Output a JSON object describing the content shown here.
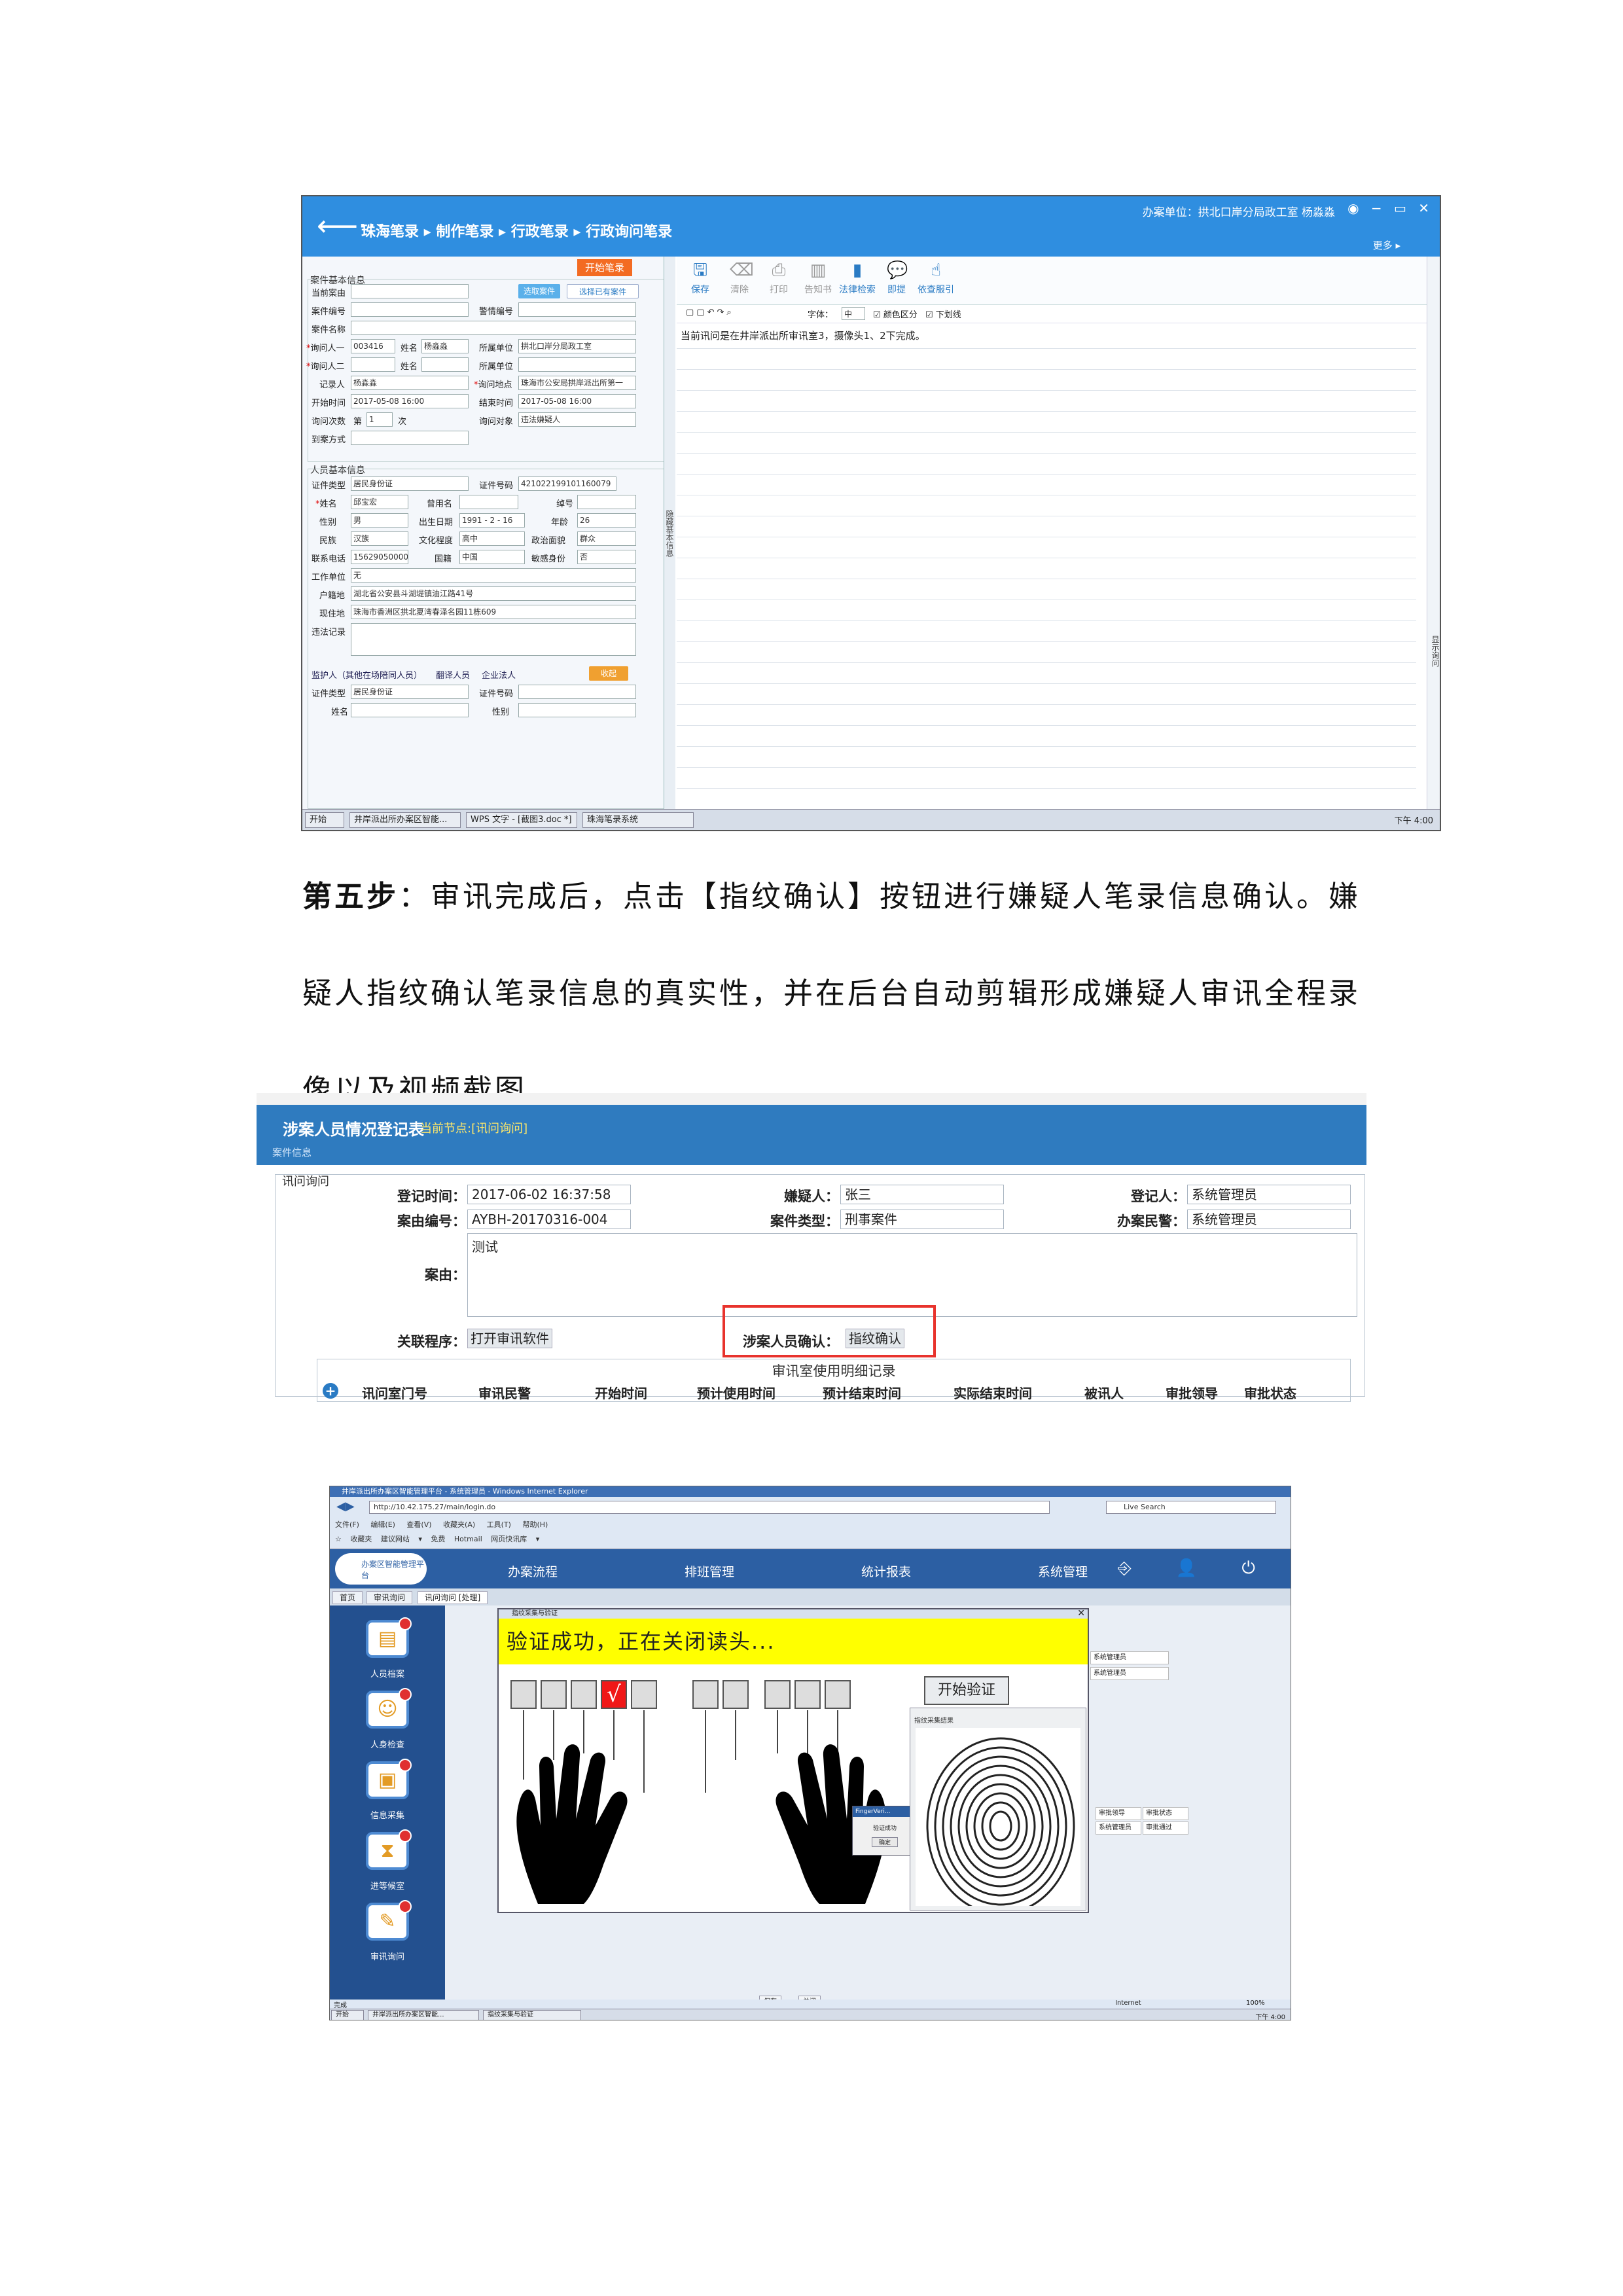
{
  "shot1": {
    "back_arrow": "⟵···",
    "breadcrumb": "珠海笔录 ▸ 制作笔录 ▸ 行政笔录 ▸ 行政询问笔录",
    "unit": "办案单位：拱北口岸分局政工室  杨淼淼",
    "win_buttons": "◉ − ▭ ✕",
    "more": "更多 ▸",
    "start_btn": "开始笔录",
    "case_section": "案件基本信息",
    "person_section": "人员基本信息",
    "fields": {
      "current_case_label": "当前案由",
      "select_case_btn": "选取案件",
      "select_existing_btn": "选择已有案件",
      "case_no_label": "案件编号",
      "alarm_no_label": "警情编号",
      "case_name_label": "案件名称",
      "asker1_label": "询问人一",
      "asker1_id": "003416",
      "name_label": "姓名",
      "asker1_name": "杨淼淼",
      "unit_label": "所属单位",
      "asker1_unit": "拱北口岸分局政工室",
      "asker2_label": "询问人二",
      "recorder_label": "记录人",
      "recorder": "杨淼淼",
      "place_label": "询问地点",
      "place": "珠海市公安局拱岸派出所第一",
      "start_label": "开始时间",
      "start_time": "2017-05-08 16:00",
      "end_label": "结束时间",
      "end_time": "2017-05-08 16:00",
      "count_label": "询问次数",
      "count_prefix": "第",
      "count_value": "1",
      "count_suffix": "次",
      "object_label": "询问对象",
      "object_value": "违法嫌疑人",
      "notify_label": "到案方式",
      "id_type_label": "证件类型",
      "id_type": "居民身份证",
      "id_no_label": "证件号码",
      "id_no": "421022199101160079",
      "pname_label": "姓名",
      "pname": "邱宝宏",
      "alias_label": "曾用名",
      "nickname_label": "绰号",
      "gender_label": "性别",
      "gender": "男",
      "birth_label": "出生日期",
      "birth": "1991 - 2 - 16",
      "age_label": "年龄",
      "age": "26",
      "nation_label": "民族",
      "nation": "汉族",
      "edu_label": "文化程度",
      "edu": "高中",
      "politics_label": "政治面貌",
      "politics": "群众",
      "phone_label": "联系电话",
      "phone": "15629050000",
      "country_label": "国籍",
      "country": "中国",
      "sensitive_label": "敏感身份",
      "sensitive": "否",
      "work_label": "工作单位",
      "work": "无",
      "household_label": "户籍地",
      "household": "湖北省公安县斗湖堤镇油江路41号",
      "current_label": "现住地",
      "current": "珠海市香洲区拱北夏湾春泽名园11栋609",
      "record_label": "违法记录",
      "guardian_tab1": "监护人（其他在场陪同人员）",
      "guardian_tab2": "翻译人员",
      "guardian_tab3": "企业法人",
      "collect_btn": "收起",
      "g_id_type_label": "证件类型",
      "g_id_type": "居民身份证",
      "g_id_no_label": "证件号码",
      "g_name_label": "姓名",
      "g_gender_label": "性别"
    },
    "divider_label": "隐藏基本信息",
    "side_label": "显示询问",
    "toolbar": [
      "保存",
      "清除",
      "打印",
      "告知书",
      "法律检索",
      "即提",
      "依查服引"
    ],
    "font_label": "字体：",
    "font_value": "中",
    "color_check": "颜色区分",
    "underline_check": "下划线",
    "body_text": "当前讯问是在井岸派出所审讯室3，摄像头1、2下完成。",
    "taskbar": [
      "开始",
      "井岸派出所办案区智能...",
      "WPS 文字 - [截图3.doc *]",
      "珠海笔录系统"
    ],
    "tray_time": "下午 4:00"
  },
  "paragraph": {
    "step_label": "第五步",
    "line1_rest": "：审讯完成后，点击【指纹确认】按钮进行嫌疑人笔录信息确认。嫌",
    "line2": "疑人指纹确认笔录信息的真实性，并在后台自动剪辑形成嫌疑人审讯全程录",
    "line3": "像以及视频截图。"
  },
  "shot2": {
    "title": "涉案人员情况登记表",
    "node": "当前节点:[讯问询问]",
    "sub": "案件信息",
    "legend": "讯问询问",
    "reg_time_label": "登记时间：",
    "reg_time": "2017-06-02 16:37:58",
    "suspect_label": "嫌疑人：",
    "suspect": "张三",
    "registrar_label": "登记人：",
    "registrar": "系统管理员",
    "case_no_label": "案由编号：",
    "case_no": "AYBH-20170316-004",
    "case_type_label": "案件类型：",
    "case_type": "刑事案件",
    "officer_label": "办案民警：",
    "officer": "系统管理员",
    "reason_label": "案由：",
    "reason": "测试",
    "program_label": "关联程序：",
    "program_btn": "打开审讯软件",
    "confirm_label": "涉案人员确认：",
    "confirm_btn": "指纹确认",
    "grid_caption": "审讯室使用明细记录",
    "grid_headers": [
      "讯问室门号",
      "审讯民警",
      "开始时间",
      "预计使用时间",
      "预计结束时间",
      "实际结束时间",
      "被讯人",
      "审批领导",
      "审批状态"
    ]
  },
  "shot3": {
    "ie_title": "井岸派出所办案区智能管理平台 - 系统管理员 - Windows Internet Explorer",
    "address": "http://10.42.175.27/main/login.do",
    "search": "Live Search",
    "menu": "文件(F) 编辑(E) 查看(V) 收藏夹(A) 工具(T) 帮助(H)",
    "favbar": "☆ 收藏夹  建议网站 ▾  免费 Hotmail  网页快讯库 ▾",
    "logo_text": "办案区智能管理平台",
    "nav": [
      "办案流程",
      "排班管理",
      "统计报表",
      "系统管理"
    ],
    "nav_icons": "⎆ 👤 ⏻",
    "tabs": [
      "首页",
      "审讯询问",
      "讯问询问 [处理]"
    ],
    "sidebar": [
      {
        "icon": "▤",
        "label": "人员档案"
      },
      {
        "icon": "☺",
        "label": "人身检查"
      },
      {
        "icon": "▣",
        "label": "信息采集"
      },
      {
        "icon": "⧗",
        "label": "进等候室"
      },
      {
        "icon": "✎",
        "label": "审讯询问"
      }
    ],
    "dialog_title": "指纹采集与验证",
    "yellow_msg": "验证成功，正在关闭读头...",
    "check_mark": "√",
    "verify_btn": "开始验证",
    "fp_label": "指纹采集结果",
    "popup_title": "FingerVeri...",
    "popup_msg": "验证成功",
    "popup_ok": "确定",
    "bg_values": [
      "系统管理员",
      "系统管理员",
      "审批领导",
      "审批状态",
      "系统管理员",
      "审批通过"
    ],
    "bottom_btns": [
      "保存",
      "关闭"
    ],
    "status": "完成",
    "internet": "Internet",
    "zoom": "100%",
    "taskbar": [
      "开始",
      "井岸派出所办案区智能...",
      "指纹采集与验证"
    ],
    "time": "下午 4:00"
  }
}
